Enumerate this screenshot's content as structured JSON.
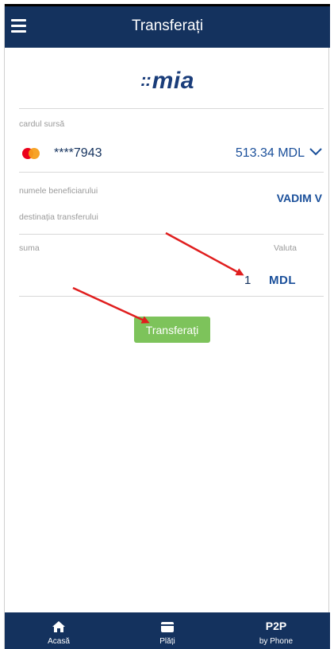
{
  "header": {
    "title": "Transferați"
  },
  "logo": {
    "dots": "::",
    "text": "mia"
  },
  "source_card": {
    "label": "cardul sursă",
    "masked_number": "****7943",
    "balance": "513.34 MDL"
  },
  "beneficiary": {
    "name_label": "numele beneficiarului",
    "name_value": "VADIM V",
    "destination_label": "destinația transferului"
  },
  "amount": {
    "label": "suma",
    "currency_label": "Valuta",
    "value": "1",
    "currency": "MDL"
  },
  "actions": {
    "transfer_label": "Transferați"
  },
  "bottom_nav": {
    "items": [
      {
        "label": "Acasă",
        "icon": "home-icon"
      },
      {
        "label": "Plăți",
        "icon": "wallet-icon"
      },
      {
        "label": "by Phone",
        "top_text": "P2P"
      }
    ]
  },
  "colors": {
    "header_bg": "#14325e",
    "accent_blue": "#1a4f9a",
    "button_green": "#7dc35b",
    "arrow_red": "#e01e1e"
  }
}
